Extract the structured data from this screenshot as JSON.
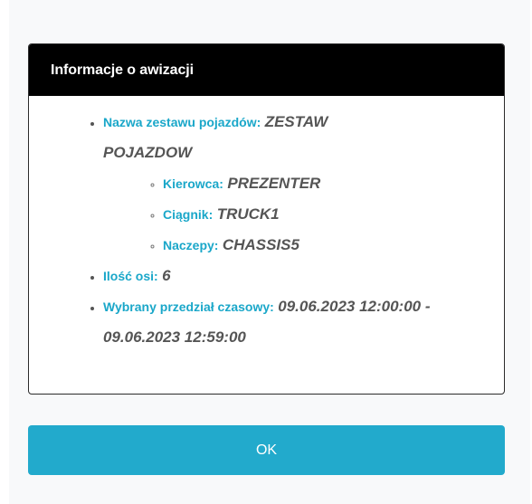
{
  "header": {
    "title": "Informacje o awizacji"
  },
  "details": {
    "vehicle_set": {
      "label": "Nazwa zestawu pojazdów:",
      "value": "ZESTAW POJAZDOW",
      "driver": {
        "label": "Kierowca:",
        "value": "PREZENTER"
      },
      "tractor": {
        "label": "Ciągnik:",
        "value": "TRUCK1"
      },
      "trailers": {
        "label": "Naczepy:",
        "value": "CHASSIS5"
      }
    },
    "axles": {
      "label": "Ilość osi:",
      "value": "6"
    },
    "time_slot": {
      "label": "Wybrany przedział czasowy:",
      "value": "09.06.2023 12:00:00 - 09.06.2023 12:59:00"
    }
  },
  "ok_button": {
    "label": "OK"
  },
  "colors": {
    "header_bg": "#000000",
    "label": "#1aa7c9",
    "value": "#555555",
    "button": "#22aacc"
  }
}
